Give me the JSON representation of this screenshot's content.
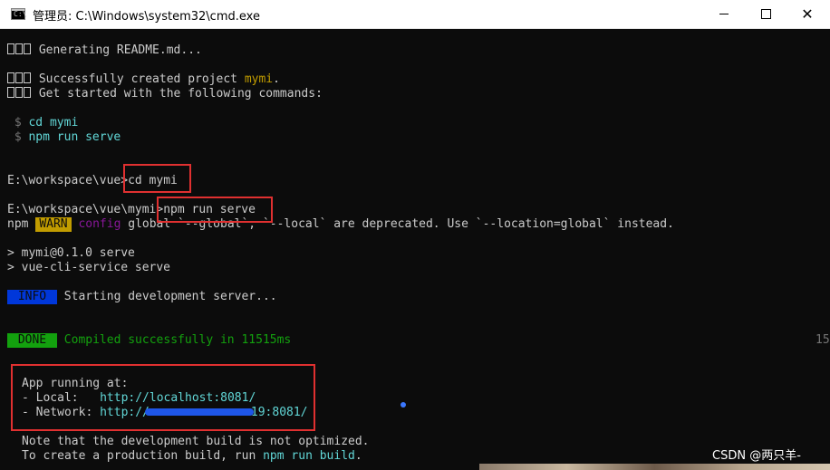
{
  "window": {
    "title": "管理员:  C:\\Windows\\system32\\cmd.exe",
    "controls": {
      "minimize": "—",
      "maximize": "☐",
      "close": "✕"
    }
  },
  "console": {
    "generating": "Generating README.md...",
    "created_prefix": "Successfully created project ",
    "created_project": "mymi",
    "created_suffix": ".",
    "get_started": "Get started with the following commands:",
    "cmd1_prompt": " $ ",
    "cmd1": "cd mymi",
    "cmd2_prompt": " $ ",
    "cmd2": "npm run serve",
    "prompt1": "E:\\workspace\\vue>",
    "input1": "cd mymi",
    "prompt2": "E:\\workspace\\vue\\mymi>",
    "input2": "npm run serve",
    "npm": "npm ",
    "warn": "WARN",
    "config": " config ",
    "warn_msg": "global `--global`, `--local` are deprecated. Use `--location=global` instead.",
    "script1": "> mymi@0.1.0 serve",
    "script2": "> vue-cli-service serve",
    "info_badge": " INFO ",
    "info_msg": " Starting development server...",
    "done_badge": " DONE ",
    "done_msg": " Compiled successfully in 11515ms",
    "done_time": "15",
    "app_running": "App running at:",
    "local_label": "- Local:   ",
    "local_url": "http://localhost:8081/",
    "network_label": "- Network: ",
    "network_url_prefix": "http://",
    "network_url_suffix": "19:8081/",
    "note": "Note that the development build is not optimized.",
    "build_prefix": "To create a production build, run ",
    "build_cmd": "npm run build",
    "build_suffix": "."
  },
  "watermark": "CSDN @两只羊-",
  "colors": {
    "background": "#0c0c0c",
    "text": "#cccccc",
    "highlight_red": "#e03030",
    "url_blue": "#3b78ff",
    "success_green": "#13a10e",
    "warn_yellow": "#c19c00"
  }
}
